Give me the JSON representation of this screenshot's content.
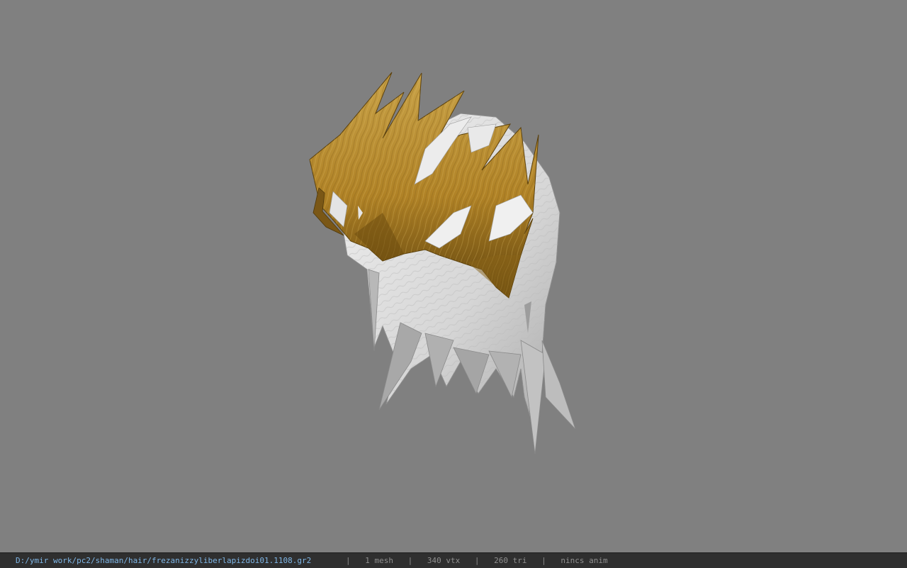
{
  "viewer": {
    "background_color": "#808080",
    "model_colors": {
      "hair_gold": "#b58a2c",
      "hair_gold_dark": "#6e4f10",
      "hair_white": "#e6e6e6",
      "hair_gray": "#bdbdbd"
    }
  },
  "statusbar": {
    "file_path": "D:/ymir work/pc2/shaman/hair/frezanizzyliberlapizdoi01.1108.gr2",
    "separator": "|",
    "mesh_count": "1 mesh",
    "vertex_count": "340 vtx",
    "triangle_count": "260 tri",
    "anim_status": "nincs anim"
  }
}
